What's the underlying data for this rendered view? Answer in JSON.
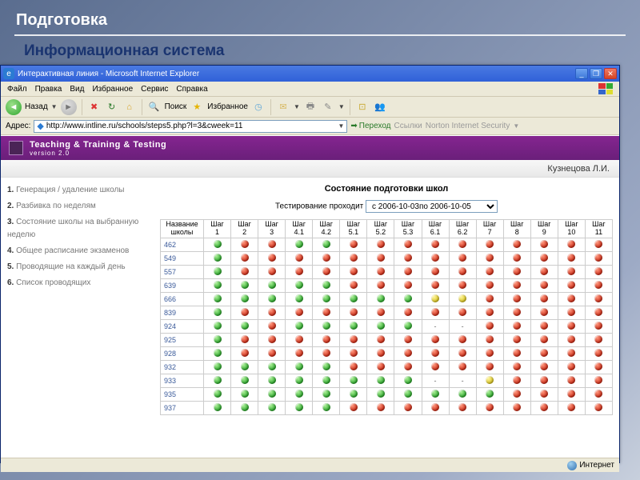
{
  "slide": {
    "title": "Подготовка",
    "subtitle": "Информационная система"
  },
  "window": {
    "title": "Интерактивная линия - Microsoft Internet Explorer"
  },
  "menu": {
    "file": "Файл",
    "edit": "Правка",
    "view": "Вид",
    "fav": "Избранное",
    "tools": "Сервис",
    "help": "Справка"
  },
  "toolbar": {
    "back": "Назад",
    "search": "Поиск",
    "favorites": "Избранное"
  },
  "address": {
    "label": "Адрес:",
    "url": "http://www.intline.ru/schools/steps5.php?l=3&cweek=11",
    "go": "Переход",
    "links": "Ссылки",
    "norton": "Norton Internet Security"
  },
  "app": {
    "title": "Teaching & Training & Testing",
    "version": "version 2.0",
    "user": "Кузнецова Л.И."
  },
  "nav": {
    "items": [
      "Генерация / удаление школы",
      "Разбивка по неделям",
      "Состояние школы на выбранную неделю",
      "Общее расписание экзаменов",
      "Проводящие на каждый день",
      "Список проводящих"
    ]
  },
  "main": {
    "heading": "Состояние подготовки школ",
    "filter_label": "Тестирование проходит",
    "filter_value": "с 2006-10-03по 2006-10-05"
  },
  "table": {
    "col_school": "Название школы",
    "cols": [
      "Шаг 1",
      "Шаг 2",
      "Шаг 3",
      "Шаг 4.1",
      "Шаг 4.2",
      "Шаг 5.1",
      "Шаг 5.2",
      "Шаг 5.3",
      "Шаг 6.1",
      "Шаг 6.2",
      "Шаг 7",
      "Шаг 8",
      "Шаг 9",
      "Шаг 10",
      "Шаг 11"
    ],
    "rows": [
      {
        "s": "462",
        "c": [
          "g",
          "r",
          "r",
          "g",
          "g",
          "r",
          "r",
          "r",
          "r",
          "r",
          "r",
          "r",
          "r",
          "r",
          "r"
        ]
      },
      {
        "s": "549",
        "c": [
          "g",
          "r",
          "r",
          "r",
          "r",
          "r",
          "r",
          "r",
          "r",
          "r",
          "r",
          "r",
          "r",
          "r",
          "r"
        ]
      },
      {
        "s": "557",
        "c": [
          "g",
          "r",
          "r",
          "r",
          "r",
          "r",
          "r",
          "r",
          "r",
          "r",
          "r",
          "r",
          "r",
          "r",
          "r"
        ]
      },
      {
        "s": "639",
        "c": [
          "g",
          "g",
          "g",
          "g",
          "g",
          "r",
          "r",
          "r",
          "r",
          "r",
          "r",
          "r",
          "r",
          "r",
          "r"
        ]
      },
      {
        "s": "666",
        "c": [
          "g",
          "g",
          "g",
          "g",
          "g",
          "g",
          "g",
          "g",
          "y",
          "y",
          "r",
          "r",
          "r",
          "r",
          "r"
        ]
      },
      {
        "s": "839",
        "c": [
          "g",
          "r",
          "r",
          "r",
          "r",
          "r",
          "r",
          "r",
          "r",
          "r",
          "r",
          "r",
          "r",
          "r",
          "r"
        ]
      },
      {
        "s": "924",
        "c": [
          "g",
          "g",
          "r",
          "g",
          "g",
          "g",
          "g",
          "g",
          "-",
          "-",
          "r",
          "r",
          "r",
          "r",
          "r"
        ]
      },
      {
        "s": "925",
        "c": [
          "g",
          "r",
          "r",
          "r",
          "r",
          "r",
          "r",
          "r",
          "r",
          "r",
          "r",
          "r",
          "r",
          "r",
          "r"
        ]
      },
      {
        "s": "928",
        "c": [
          "g",
          "r",
          "r",
          "r",
          "r",
          "r",
          "r",
          "r",
          "r",
          "r",
          "r",
          "r",
          "r",
          "r",
          "r"
        ]
      },
      {
        "s": "932",
        "c": [
          "g",
          "g",
          "g",
          "g",
          "g",
          "r",
          "r",
          "r",
          "r",
          "r",
          "r",
          "r",
          "r",
          "r",
          "r"
        ]
      },
      {
        "s": "933",
        "c": [
          "g",
          "g",
          "g",
          "g",
          "g",
          "g",
          "g",
          "g",
          "-",
          "-",
          "y",
          "r",
          "r",
          "r",
          "r"
        ]
      },
      {
        "s": "935",
        "c": [
          "g",
          "g",
          "g",
          "g",
          "g",
          "g",
          "g",
          "g",
          "g",
          "g",
          "g",
          "r",
          "r",
          "r",
          "r"
        ]
      },
      {
        "s": "937",
        "c": [
          "g",
          "g",
          "g",
          "g",
          "g",
          "r",
          "r",
          "r",
          "r",
          "r",
          "r",
          "r",
          "r",
          "r",
          "r"
        ]
      }
    ]
  },
  "status": {
    "zone": "Интернет"
  }
}
